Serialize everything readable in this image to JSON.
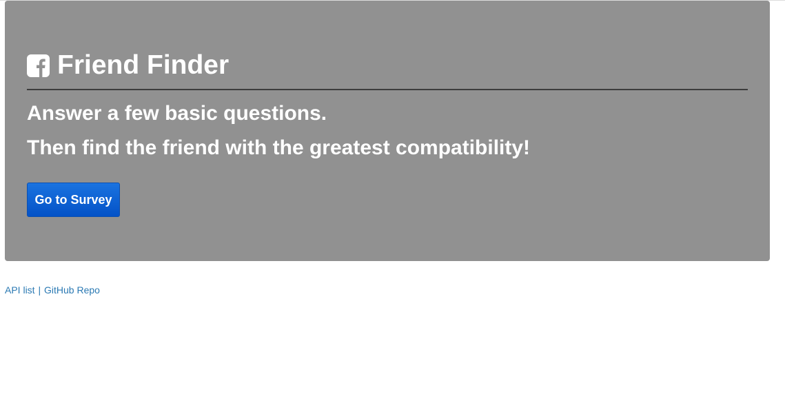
{
  "jumbotron": {
    "title": "Friend Finder",
    "icon": "facebook-square-icon",
    "tagline_1": "Answer a few basic questions.",
    "tagline_2": "Then find the friend with the greatest compatibility!",
    "survey_button_label": "Go to Survey",
    "background_color": "#919191",
    "button_color": "#0a5fd6"
  },
  "footer": {
    "api_link_label": "API list",
    "separator": "|",
    "github_link_label": "GitHub Repo",
    "link_color": "#2a79b3"
  }
}
